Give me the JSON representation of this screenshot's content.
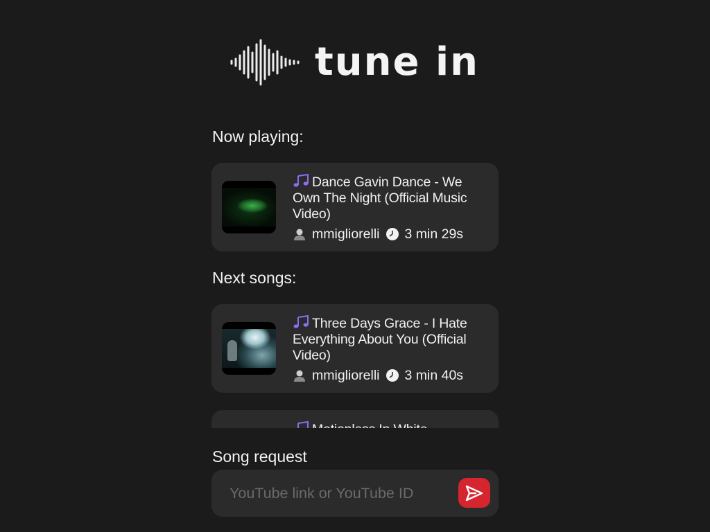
{
  "app": {
    "logo_text": "tune in"
  },
  "now_playing": {
    "label": "Now playing:",
    "song": {
      "title": "Dance Gavin Dance - We Own The Night (Official Music Video)",
      "user": "mmigliorelli",
      "duration": "3 min 29s"
    }
  },
  "next_songs": {
    "label": "Next songs:",
    "items": [
      {
        "title": "Three Days Grace - I Hate Everything About You (Official Video)",
        "user": "mmigliorelli",
        "duration": "3 min 40s"
      },
      {
        "title": "Motionless In White",
        "user": "",
        "duration": ""
      }
    ]
  },
  "request": {
    "label": "Song request",
    "placeholder": "YouTube link or YouTube ID"
  },
  "colors": {
    "background": "#1b1b1c",
    "card": "#2b2b2c",
    "accent_note": "#8e6cf0",
    "send_button": "#d5252e"
  },
  "icons": {
    "logo": "sound-wave-icon",
    "song": "music-note-icon",
    "user": "user-icon",
    "duration": "clock-icon",
    "send": "send-icon"
  }
}
